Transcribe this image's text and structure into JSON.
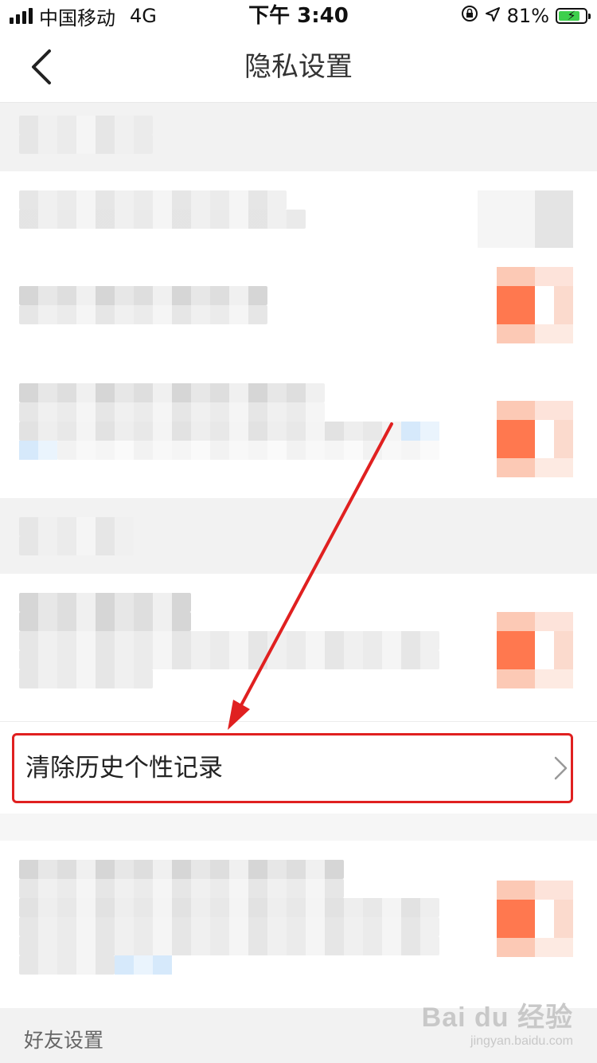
{
  "status_bar": {
    "carrier": "中国移动",
    "network": "4G",
    "time": "下午 3:40",
    "battery_percent": "81%",
    "battery_level": 0.81
  },
  "nav": {
    "title": "隐私设置"
  },
  "rows": {
    "clear_history_label": "清除历史个性记录"
  },
  "sections": {
    "friends_header": "好友设置"
  },
  "watermark": {
    "brand": "Bai du 经验",
    "url": "jingyan.baidu.com"
  },
  "colors": {
    "accent": "#ff6a3c",
    "annotation_red": "#e02020"
  }
}
